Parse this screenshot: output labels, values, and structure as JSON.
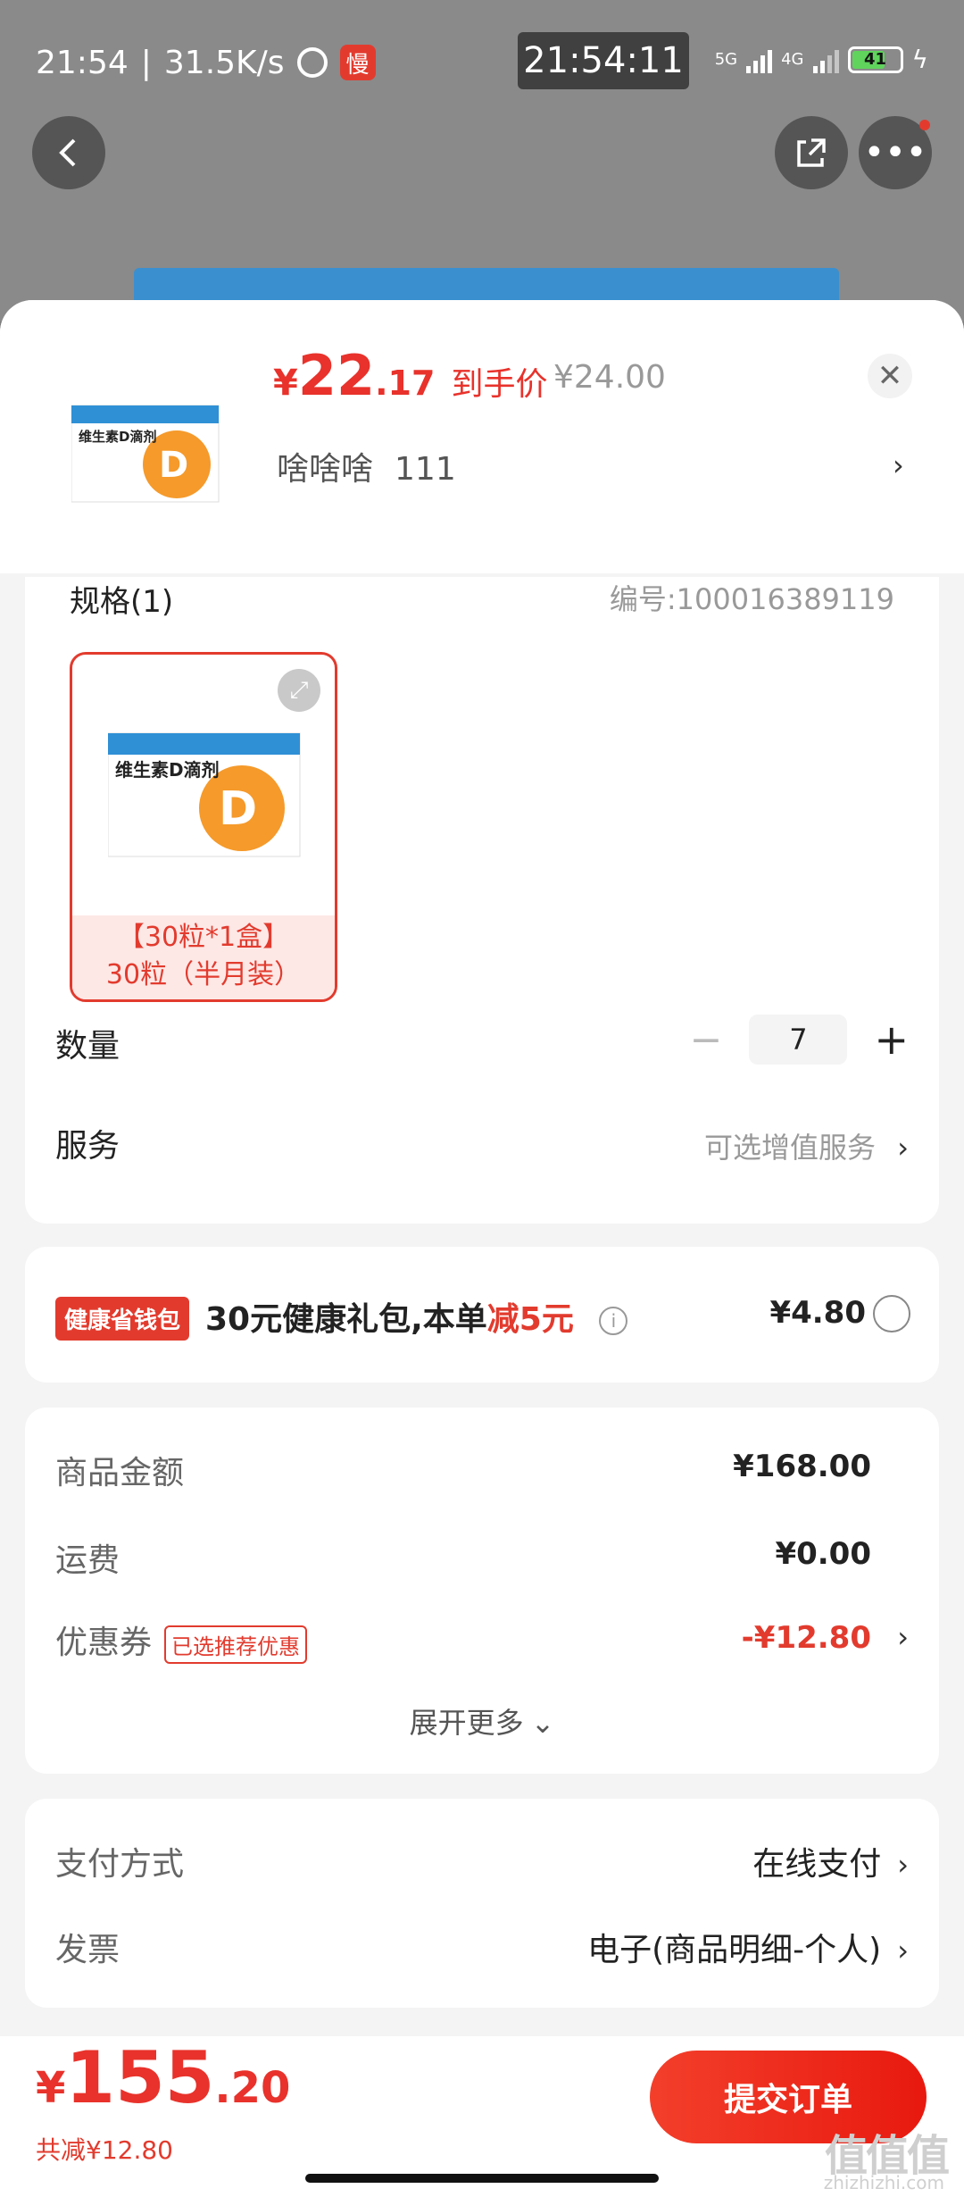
{
  "status_bar": {
    "time": "21:54",
    "net_speed": "31.5K/s",
    "app_badge": "慢",
    "clock_overlay": "21:54:11",
    "net_5g": "5G",
    "net_4g": "4G",
    "battery": "41"
  },
  "product": {
    "price_currency": "¥",
    "price_int": "22",
    "price_dec": ".17",
    "price_label": "到手价",
    "original_price": "¥24.00",
    "selected_label": "啥啥啥",
    "selected_value": "111",
    "thumb_name": "维生素D滴剂"
  },
  "spec": {
    "title": "规格(1)",
    "code": "编号:100016389119",
    "option_line1": "【30粒*1盒】",
    "option_line2": "30粒（半月装）",
    "option_img_name": "维生素D滴剂"
  },
  "quantity": {
    "label": "数量",
    "value": "7",
    "minus": "−",
    "plus": "+"
  },
  "service": {
    "label": "服务",
    "value": "可选增值服务"
  },
  "wallet": {
    "badge": "健康省钱包",
    "text_prefix": "30元健康礼包,本单",
    "text_highlight": "减5元",
    "price": "¥4.80"
  },
  "summary": {
    "goods_label": "商品金额",
    "goods_value": "¥168.00",
    "shipping_label": "运费",
    "shipping_value": "¥0.00",
    "coupon_label": "优惠券",
    "coupon_tag": "已选推荐优惠",
    "coupon_value": "-¥12.80",
    "expand_more": "展开更多"
  },
  "payment": {
    "method_label": "支付方式",
    "method_value": "在线支付",
    "invoice_label": "发票",
    "invoice_value": "电子(商品明细-个人)"
  },
  "footer": {
    "total_currency": "¥",
    "total_int": "155",
    "total_dec": ".20",
    "saved": "共减¥12.80",
    "submit": "提交订单"
  },
  "watermark": {
    "logo": "值值值",
    "site": "zhizhizhi.com"
  },
  "colors": {
    "accent": "#e8322b",
    "badge_red": "#e23b2e",
    "option_bg": "#fde8e6"
  }
}
